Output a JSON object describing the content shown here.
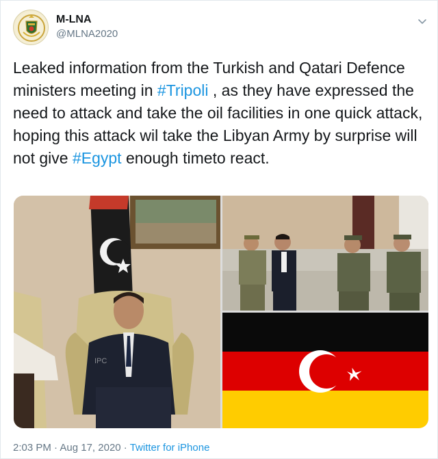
{
  "author": {
    "name": "M-LNA",
    "handle": "@MLNA2020"
  },
  "tweet": {
    "segments": [
      {
        "text": "Leaked information from the Turkish and Qatari Defence ministers meeting in ",
        "type": "text"
      },
      {
        "text": "#Tripoli",
        "type": "hashtag"
      },
      {
        "text": " , as they have expressed the need to attack and take the oil facilities in one quick attack,  hoping this attack wil take the Libyan Army by surprise will not give ",
        "type": "text"
      },
      {
        "text": "#Egypt",
        "type": "hashtag"
      },
      {
        "text": " enough timeto react.",
        "type": "text"
      }
    ]
  },
  "footer": {
    "time": "2:03 PM",
    "separator1": " · ",
    "date": "Aug 17, 2020",
    "separator2": " · ",
    "source": "Twitter for iPhone"
  },
  "icons": {
    "avatar": "emblem-icon",
    "menu": "chevron-down-icon"
  },
  "colors": {
    "link": "#1b95e0",
    "secondary_text": "#657786"
  }
}
